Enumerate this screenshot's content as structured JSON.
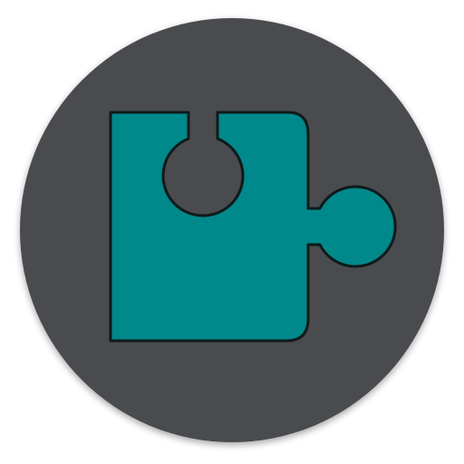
{
  "icon": {
    "name": "puzzle-piece-icon",
    "background_color": "#4a4b4f",
    "shadow_color": "#3a3b3e",
    "piece_color": "#00898a",
    "outline_color": "#0f1a1a"
  }
}
